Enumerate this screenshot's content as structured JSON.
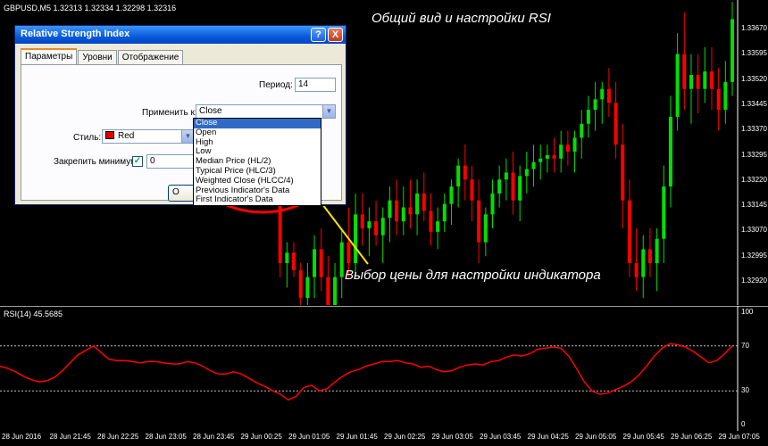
{
  "symbol_label": "GBPUSD,M5  1.32313 1.32334 1.32298 1.32316",
  "callouts": {
    "title": "Общий вид и настройки RSI",
    "price": "Выбор цены для настройки индикатора"
  },
  "dialog": {
    "title": "Relative Strength Index",
    "help": "?",
    "close": "X",
    "tabs": [
      "Параметры",
      "Уровни",
      "Отображение"
    ],
    "period_label": "Период:",
    "period_value": "14",
    "apply_label": "Применить к:",
    "apply_value": "Close",
    "style_label": "Стиль:",
    "style_value": "Red",
    "fix_min_label": "Закрепить минимум",
    "fix_min_value": "0",
    "ok_button": "О",
    "dropdown_options": [
      "Close",
      "Open",
      "High",
      "Low",
      "Median Price (HL/2)",
      "Typical Price (HLC/3)",
      "Weighted Close (HLCC/4)",
      "Previous Indicator's Data",
      "First Indicator's Data"
    ],
    "selected_option": "Close"
  },
  "price_axis": [
    "1.33670",
    "1.33595",
    "1.33520",
    "1.33445",
    "1.33370",
    "1.33295",
    "1.33220",
    "1.33145",
    "1.33070",
    "1.32995",
    "1.32920"
  ],
  "rsi": {
    "label": "RSI(14) 45.5685",
    "ticks": [
      "100",
      "70",
      "30",
      "0"
    ],
    "levels": [
      70,
      30
    ],
    "color": "#ff0000",
    "values": [
      52,
      50,
      47,
      43,
      40,
      38,
      39,
      42,
      48,
      55,
      62,
      66,
      70,
      64,
      58,
      57,
      57,
      56,
      55,
      56,
      56,
      55,
      54,
      54,
      56,
      55,
      52,
      48,
      45,
      45,
      47,
      45,
      41,
      37,
      34,
      30,
      27,
      22,
      25,
      33,
      35,
      30,
      32,
      38,
      43,
      47,
      49,
      52,
      54,
      56,
      56,
      57,
      55,
      54,
      51,
      52,
      49,
      47,
      48,
      51,
      53,
      54,
      53,
      56,
      57,
      60,
      62,
      61,
      63,
      67,
      68,
      69,
      68,
      61,
      50,
      38,
      30,
      27,
      28,
      31,
      34,
      38,
      44,
      52,
      61,
      68,
      72,
      71,
      69,
      65,
      60,
      55,
      57,
      63,
      70
    ]
  },
  "time_axis": [
    "28 Jun 2016",
    "28 Jun 21:45",
    "28 Jun 22:25",
    "28 Jun 23:05",
    "28 Jun 23:45",
    "29 Jun 00:25",
    "29 Jun 01:05",
    "29 Jun 01:45",
    "29 Jun 02:25",
    "29 Jun 03:05",
    "29 Jun 03:45",
    "29 Jun 04:25",
    "29 Jun 05:05",
    "29 Jun 05:45",
    "29 Jun 06:25",
    "29 Jun 07:05"
  ],
  "candles": {
    "up_color": "#00e000",
    "down_color": "#ff0000",
    "price_range": [
      1.3289,
      1.3375
    ],
    "data": [
      [
        1.3353,
        1.3355,
        1.335,
        1.3353
      ],
      [
        1.3328,
        1.3336,
        1.3296,
        1.33
      ],
      [
        1.33,
        1.3306,
        1.3293,
        1.3303
      ],
      [
        1.3303,
        1.3306,
        1.3296,
        1.3298
      ],
      [
        1.3298,
        1.33,
        1.3285,
        1.329
      ],
      [
        1.329,
        1.33,
        1.3284,
        1.3296
      ],
      [
        1.3296,
        1.3308,
        1.329,
        1.3304
      ],
      [
        1.3304,
        1.331,
        1.3292,
        1.3296
      ],
      [
        1.3296,
        1.3302,
        1.3282,
        1.3287
      ],
      [
        1.3287,
        1.33,
        1.3283,
        1.3296
      ],
      [
        1.3296,
        1.331,
        1.329,
        1.3306
      ],
      [
        1.3306,
        1.3316,
        1.3296,
        1.33
      ],
      [
        1.33,
        1.332,
        1.3296,
        1.3314
      ],
      [
        1.3314,
        1.332,
        1.3305,
        1.331
      ],
      [
        1.331,
        1.3316,
        1.3302,
        1.3312
      ],
      [
        1.3312,
        1.3318,
        1.3305,
        1.3308
      ],
      [
        1.3308,
        1.3316,
        1.33,
        1.3313
      ],
      [
        1.3313,
        1.3322,
        1.3306,
        1.3318
      ],
      [
        1.3318,
        1.3324,
        1.3308,
        1.3312
      ],
      [
        1.3312,
        1.3322,
        1.3308,
        1.3316
      ],
      [
        1.3316,
        1.3324,
        1.331,
        1.3314
      ],
      [
        1.3314,
        1.3324,
        1.3308,
        1.332
      ],
      [
        1.332,
        1.3326,
        1.3312,
        1.3315
      ],
      [
        1.3315,
        1.332,
        1.3305,
        1.3309
      ],
      [
        1.3309,
        1.3316,
        1.3304,
        1.3312
      ],
      [
        1.3312,
        1.332,
        1.3309,
        1.3317
      ],
      [
        1.3317,
        1.3324,
        1.3311,
        1.3322
      ],
      [
        1.3322,
        1.333,
        1.3316,
        1.3328
      ],
      [
        1.3328,
        1.3334,
        1.3318,
        1.3324
      ],
      [
        1.3324,
        1.3328,
        1.3312,
        1.3318
      ],
      [
        1.3318,
        1.3324,
        1.33,
        1.3306
      ],
      [
        1.3306,
        1.3316,
        1.3302,
        1.3314
      ],
      [
        1.3314,
        1.3324,
        1.331,
        1.332
      ],
      [
        1.332,
        1.3328,
        1.3316,
        1.3324
      ],
      [
        1.3324,
        1.333,
        1.3318,
        1.3326
      ],
      [
        1.3326,
        1.3332,
        1.3314,
        1.3318
      ],
      [
        1.3318,
        1.3328,
        1.3312,
        1.3325
      ],
      [
        1.3325,
        1.3332,
        1.332,
        1.3327
      ],
      [
        1.3327,
        1.3334,
        1.3322,
        1.3329
      ],
      [
        1.3329,
        1.3334,
        1.3324,
        1.333
      ],
      [
        1.333,
        1.3334,
        1.3326,
        1.3331
      ],
      [
        1.3331,
        1.3336,
        1.3326,
        1.333
      ],
      [
        1.333,
        1.3338,
        1.3326,
        1.3334
      ],
      [
        1.3334,
        1.3338,
        1.3328,
        1.3332
      ],
      [
        1.3332,
        1.3338,
        1.3326,
        1.3336
      ],
      [
        1.3336,
        1.3344,
        1.333,
        1.334
      ],
      [
        1.334,
        1.3348,
        1.3336,
        1.3344
      ],
      [
        1.3344,
        1.3352,
        1.3338,
        1.3347
      ],
      [
        1.3347,
        1.3352,
        1.334,
        1.335
      ],
      [
        1.335,
        1.3356,
        1.3342,
        1.3346
      ],
      [
        1.3346,
        1.3352,
        1.333,
        1.3334
      ],
      [
        1.3334,
        1.334,
        1.331,
        1.3318
      ],
      [
        1.3318,
        1.3324,
        1.3296,
        1.33
      ],
      [
        1.33,
        1.331,
        1.3292,
        1.3296
      ],
      [
        1.3296,
        1.3308,
        1.329,
        1.3304
      ],
      [
        1.3304,
        1.331,
        1.3296,
        1.33
      ],
      [
        1.33,
        1.331,
        1.3292,
        1.3307
      ],
      [
        1.3307,
        1.3328,
        1.33,
        1.3322
      ],
      [
        1.3322,
        1.3348,
        1.3316,
        1.3342
      ],
      [
        1.3342,
        1.3366,
        1.3338,
        1.336
      ],
      [
        1.336,
        1.3372,
        1.3344,
        1.335
      ],
      [
        1.335,
        1.336,
        1.334,
        1.3354
      ],
      [
        1.3354,
        1.336,
        1.3343,
        1.335
      ],
      [
        1.335,
        1.3362,
        1.3346,
        1.3355
      ],
      [
        1.3355,
        1.3362,
        1.3344,
        1.335
      ],
      [
        1.335,
        1.3356,
        1.3338,
        1.3344
      ],
      [
        1.3344,
        1.3358,
        1.334,
        1.3352
      ],
      [
        1.3352,
        1.3375,
        1.3348,
        1.337
      ]
    ]
  }
}
